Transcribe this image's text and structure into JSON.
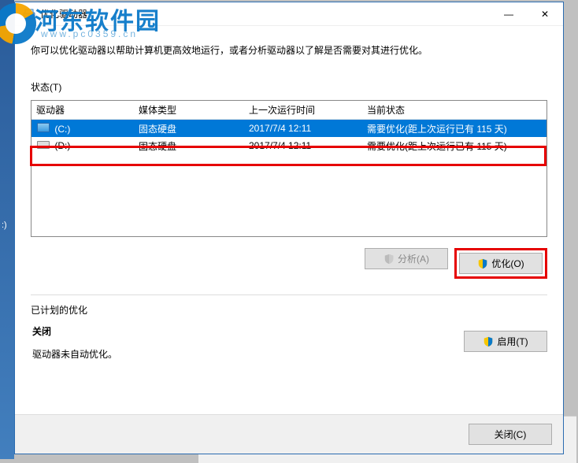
{
  "window": {
    "title": "优化驱动器",
    "minimize": "—",
    "close": "✕"
  },
  "description": "你可以优化驱动器以帮助计算机更高效地运行，或者分析驱动器以了解是否需要对其进行优化。",
  "status_label": "状态(T)",
  "columns": {
    "drive": "驱动器",
    "media": "媒体类型",
    "lastrun": "上一次运行时间",
    "state": "当前状态"
  },
  "rows": [
    {
      "drive": "(C:)",
      "media": "固态硬盘",
      "lastrun": "2017/7/4 12:11",
      "state": "需要优化(距上次运行已有 115 天)",
      "selected": true
    },
    {
      "drive": "(D:)",
      "media": "固态硬盘",
      "lastrun": "2017/7/4 12:11",
      "state": "需要优化(距上次运行已有 115 天)",
      "selected": false
    }
  ],
  "buttons": {
    "analyze": "分析(A)",
    "optimize": "优化(O)",
    "enable": "启用(T)",
    "close": "关闭(C)"
  },
  "schedule": {
    "section_label": "已计划的优化",
    "title": "关闭",
    "sub": "驱动器未自动优化。"
  },
  "watermark": {
    "brand": "河东软件园",
    "url": "www.pc0359.cn"
  },
  "leftstrip": ":)"
}
